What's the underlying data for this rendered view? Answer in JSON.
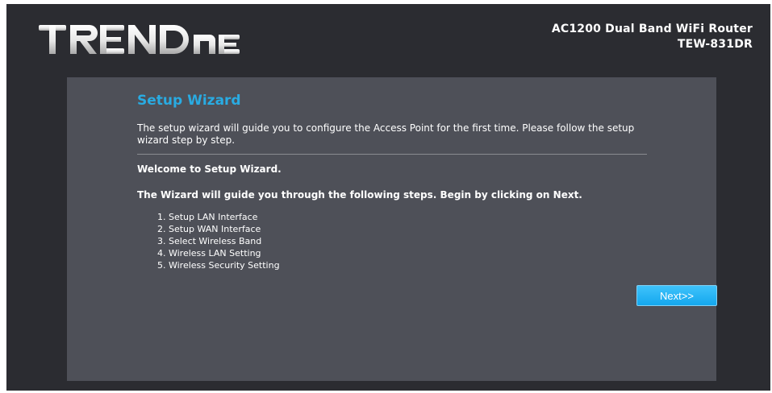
{
  "header": {
    "logo_text": "TRENDnET",
    "product_name": "AC1200 Dual Band WiFi Router",
    "model": "TEW-831DR"
  },
  "wizard": {
    "title": "Setup Wizard",
    "intro": "The setup wizard will guide you to configure the Access Point for the first time. Please follow the setup wizard step by step.",
    "welcome": "Welcome to Setup Wizard.",
    "guide": "The Wizard will guide you through the following steps. Begin by clicking on Next.",
    "steps": [
      "1. Setup LAN Interface",
      "2. Setup WAN Interface",
      "3. Select Wireless Band",
      "4. Wireless LAN Setting",
      "5. Wireless Security Setting"
    ],
    "next_label": "Next>>"
  },
  "colors": {
    "background": "#2b2c31",
    "panel": "#4e5058",
    "title": "#29abe2",
    "button": "#1eb1f3"
  }
}
